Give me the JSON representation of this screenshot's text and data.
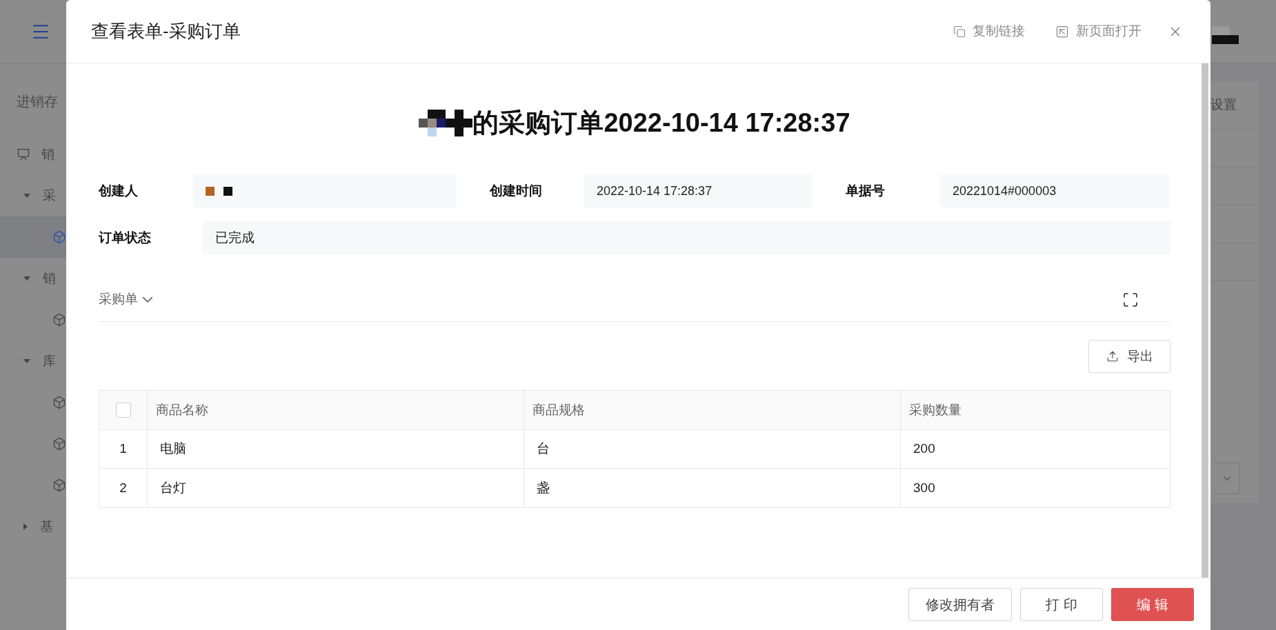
{
  "background": {
    "sidebar_title": "进销存",
    "sidebar_items": [
      {
        "kind": "group",
        "label": "销",
        "selected": false
      },
      {
        "kind": "folder",
        "label": "采",
        "expanded": true,
        "selected": false
      },
      {
        "kind": "leaf",
        "selected": true
      },
      {
        "kind": "folder",
        "label": "销",
        "expanded": true,
        "selected": false
      },
      {
        "kind": "leaf",
        "selected": false
      },
      {
        "kind": "folder",
        "label": "库",
        "expanded": true,
        "selected": false
      },
      {
        "kind": "leaf",
        "selected": false
      },
      {
        "kind": "leaf",
        "selected": false
      },
      {
        "kind": "leaf",
        "selected": false
      },
      {
        "kind": "folder",
        "label": "基",
        "expanded": false,
        "selected": false
      }
    ],
    "right_tab": "设置"
  },
  "dialog": {
    "title": "查看表单-采购订单",
    "actions": [
      {
        "kind": "copy",
        "label": "复制链接"
      },
      {
        "kind": "open",
        "label": "新页面打开"
      }
    ],
    "heading": "的采购订单2022-10-14 17:28:37",
    "fields": [
      {
        "label": "创建人",
        "redacted": true
      },
      {
        "label": "创建时间",
        "value": "2022-10-14 17:28:37",
        "redacted": false
      },
      {
        "label": "单据号",
        "value": "20221014#000003",
        "redacted": false
      }
    ],
    "status_field": {
      "label": "订单状态",
      "value": "已完成"
    },
    "tab": {
      "label": "采购单"
    },
    "export_button": "导出",
    "table": {
      "columns": [
        "商品名称",
        "商品规格",
        "采购数量"
      ],
      "all_checked": false,
      "rows": [
        {
          "index": "1",
          "cells": [
            "电脑",
            "台",
            "200"
          ]
        },
        {
          "index": "2",
          "cells": [
            "台灯",
            "盏",
            "300"
          ]
        }
      ]
    },
    "buttons": [
      {
        "kind": "default",
        "label": "修改拥有者"
      },
      {
        "kind": "default",
        "label": "打 印"
      },
      {
        "kind": "primary",
        "label": "编 辑"
      }
    ]
  }
}
